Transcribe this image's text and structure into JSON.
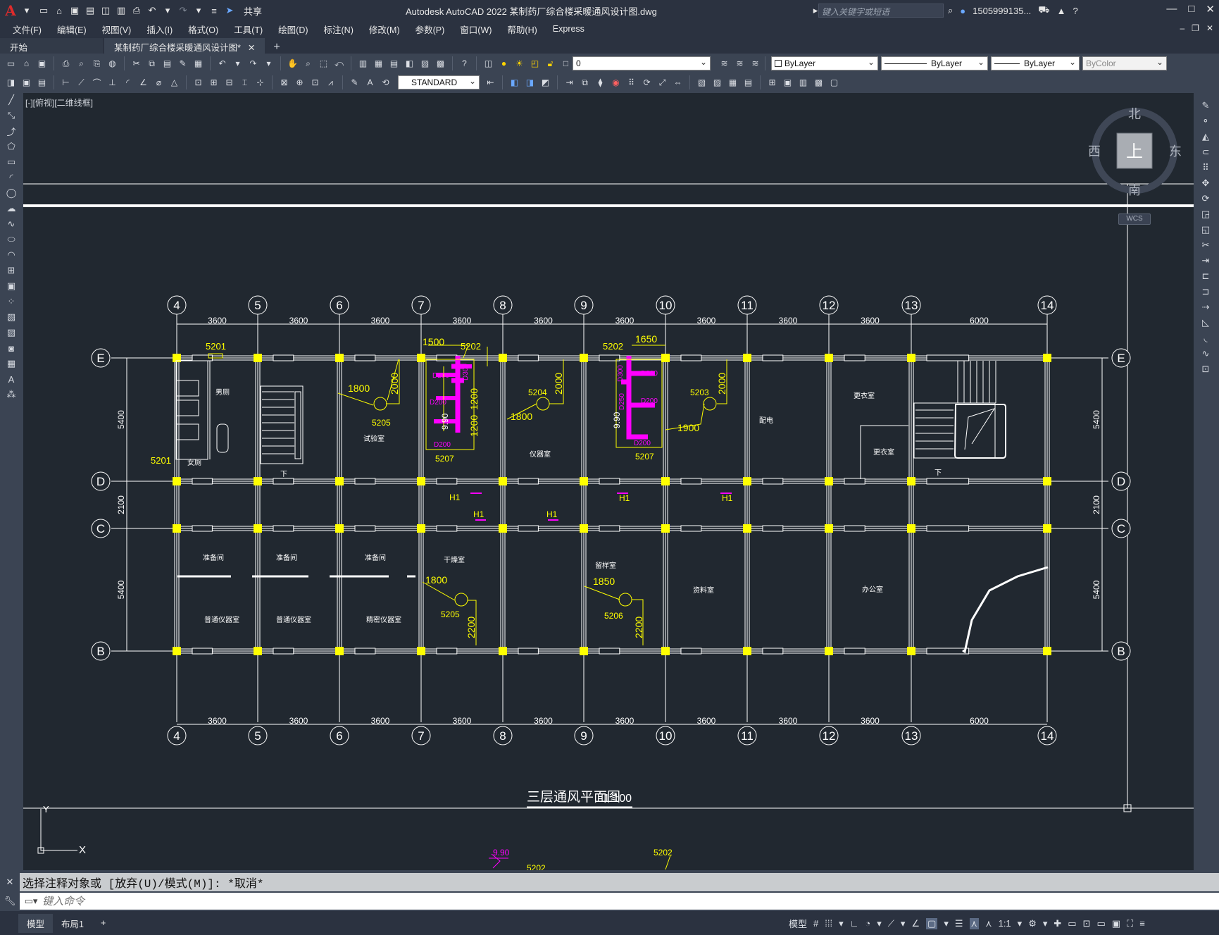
{
  "window": {
    "app_logo": "A",
    "title": "Autodesk AutoCAD 2022    某制药厂综合楼采暖通风设计图.dwg",
    "share_label": "共享",
    "search_placeholder": "键入关键字或短语",
    "user": "1505999135...",
    "controls": [
      "—",
      "□",
      "✕"
    ]
  },
  "menu": [
    "文件(F)",
    "编辑(E)",
    "视图(V)",
    "插入(I)",
    "格式(O)",
    "工具(T)",
    "绘图(D)",
    "标注(N)",
    "修改(M)",
    "参数(P)",
    "窗口(W)",
    "帮助(H)",
    "Express"
  ],
  "tabs": [
    {
      "label": "开始",
      "active": false
    },
    {
      "label": "某制药厂综合楼采暖通风设计图*",
      "active": true
    }
  ],
  "toolbar": {
    "layer_value": "0",
    "color_value": "ByLayer",
    "linetype_value": "ByLayer",
    "lineweight_value": "ByLayer",
    "plotstyle_value": "ByColor",
    "textstyle_value": "STANDARD"
  },
  "viewport_label": "[-][俯视][二维线框]",
  "viewcube": {
    "north": "北",
    "south": "南",
    "east": "东",
    "west": "西",
    "face": "上",
    "wcs": "WCS"
  },
  "drawing": {
    "title": "三层通风平面图",
    "scale": "1:100",
    "axes_x": [
      "4",
      "5",
      "6",
      "7",
      "8",
      "9",
      "10",
      "11",
      "12",
      "13",
      "14"
    ],
    "axes_y": [
      "E",
      "D",
      "C",
      "B"
    ],
    "spans": [
      "3600",
      "3600",
      "3600",
      "3600",
      "3600",
      "3600",
      "3600",
      "3600",
      "3600",
      "6000"
    ],
    "row_dims_left": [
      "5400",
      "2100",
      "5400"
    ],
    "row_dims_right": [
      "5400",
      "2100",
      "5400"
    ],
    "rooms": [
      "男厕",
      "女厕",
      "试验室",
      "仪器室",
      "配电",
      "更衣室",
      "更衣室",
      "准备间",
      "准备间",
      "准备间",
      "干燥室",
      "留样室",
      "资料室",
      "办公室",
      "普通仪器室",
      "普通仪器室",
      "精密仪器室"
    ],
    "tags": {
      "t5201a": "5201",
      "t5201b": "5201",
      "t5202a": "5202",
      "t5202b": "5202",
      "t5203": "5203",
      "t5204": "5204",
      "t5205a": "5205",
      "t5205b": "5205",
      "t5206": "5206",
      "t5207a": "5207",
      "t5207b": "5207",
      "h1": "H1",
      "elev": "9.90",
      "d1500": "1500",
      "d1650": "1650",
      "d1800a": "1800",
      "d1800b": "1800",
      "d1800c": "1800",
      "d1850": "1850",
      "d1900": "1900",
      "d2000": "2000",
      "d1200": "1200",
      "d2200": "2200",
      "d200": "D200",
      "d250": "D250",
      "d300": "D300",
      "stair_down": "下"
    },
    "ucs": {
      "x": "X",
      "y": "Y"
    }
  },
  "command": {
    "history": "选择注释对象或 [放弃(U)/模式(M)]: *取消*",
    "placeholder": "键入命令"
  },
  "status": {
    "layouts": [
      {
        "label": "模型",
        "active": true
      },
      {
        "label": "布局1",
        "active": false
      }
    ],
    "model_label": "模型",
    "scale": "1:1"
  },
  "colors": {
    "accent_magenta": "#ff00ff",
    "column_yellow": "#ffff00",
    "line_white": "#ffffff",
    "bg": "#212830"
  }
}
